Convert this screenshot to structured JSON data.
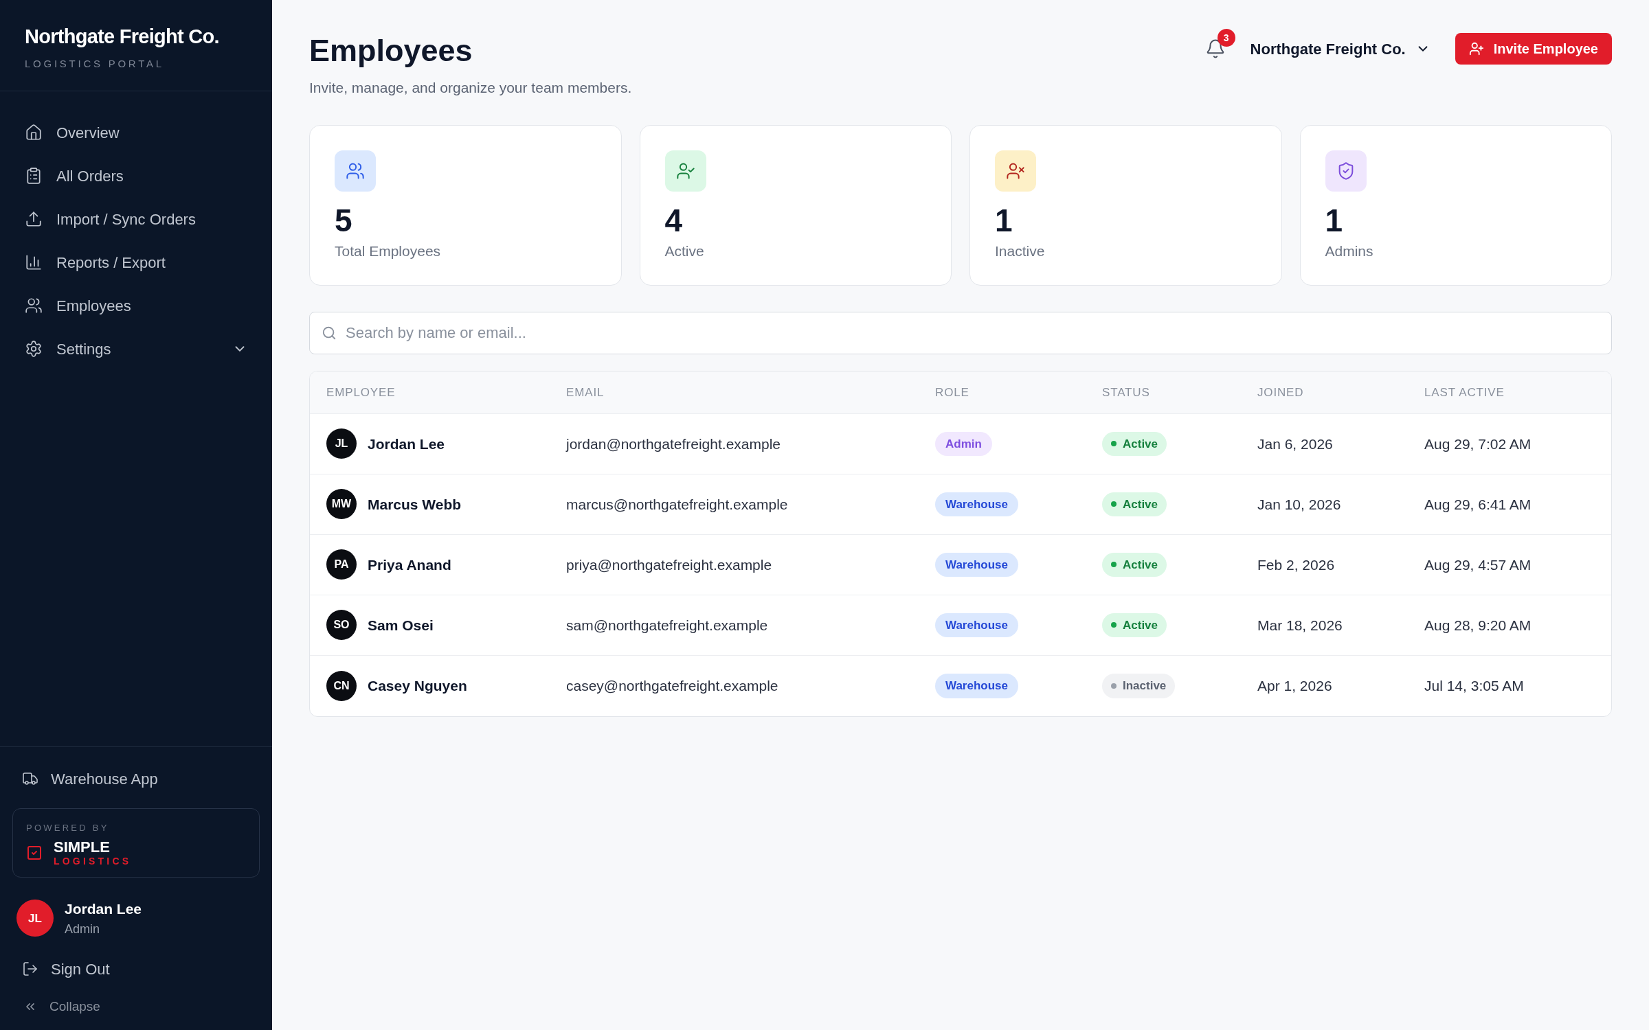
{
  "sidebar": {
    "brand": {
      "name": "Northgate Freight Co.",
      "tagline": "LOGISTICS PORTAL"
    },
    "nav": [
      {
        "label": "Overview",
        "kind": "home",
        "selected": false
      },
      {
        "label": "All Orders",
        "kind": "orders",
        "selected": false
      },
      {
        "label": "Import / Sync Orders",
        "kind": "upload",
        "selected": false
      },
      {
        "label": "Reports / Export",
        "kind": "chart",
        "selected": false
      },
      {
        "label": "Employees",
        "kind": "users",
        "selected": false
      },
      {
        "label": "Settings",
        "kind": "settings",
        "selected": false,
        "expanded": false
      }
    ],
    "warehouse_link": "Warehouse App",
    "powered_by": {
      "caption": "POWERED BY",
      "name": "SIMPLE",
      "subname": "LOGISTICS"
    },
    "user": {
      "initials": "JL",
      "name": "Jordan Lee",
      "role": "Admin"
    },
    "sign_out": "Sign Out",
    "collapse": "Collapse"
  },
  "header": {
    "notifications": "3",
    "company": "Northgate Freight Co.",
    "invite_button": "Invite Employee"
  },
  "page": {
    "title": "Employees",
    "subtitle": "Invite, manage, and organize your team members."
  },
  "stats": [
    {
      "kind": "total",
      "value": "5",
      "label": "Total Employees"
    },
    {
      "kind": "active",
      "value": "4",
      "label": "Active"
    },
    {
      "kind": "inactive",
      "value": "1",
      "label": "Inactive"
    },
    {
      "kind": "admins",
      "value": "1",
      "label": "Admins"
    }
  ],
  "search": {
    "placeholder": "Search by name or email..."
  },
  "table": {
    "columns": [
      "EMPLOYEE",
      "EMAIL",
      "ROLE",
      "STATUS",
      "JOINED",
      "LAST ACTIVE"
    ],
    "rows": [
      {
        "initials": "JL",
        "name": "Jordan Lee",
        "email": "jordan@northgatefreight.example",
        "role": {
          "kind": "admin",
          "label": "Admin"
        },
        "status": {
          "kind": "active",
          "label": "Active"
        },
        "joined": "Jan 6, 2026",
        "last_active": "Aug 29, 7:02 AM"
      },
      {
        "initials": "MW",
        "name": "Marcus Webb",
        "email": "marcus@northgatefreight.example",
        "role": {
          "kind": "warehouse",
          "label": "Warehouse"
        },
        "status": {
          "kind": "active",
          "label": "Active"
        },
        "joined": "Jan 10, 2026",
        "last_active": "Aug 29, 6:41 AM"
      },
      {
        "initials": "PA",
        "name": "Priya Anand",
        "email": "priya@northgatefreight.example",
        "role": {
          "kind": "warehouse",
          "label": "Warehouse"
        },
        "status": {
          "kind": "active",
          "label": "Active"
        },
        "joined": "Feb 2, 2026",
        "last_active": "Aug 29, 4:57 AM"
      },
      {
        "initials": "SO",
        "name": "Sam Osei",
        "email": "sam@northgatefreight.example",
        "role": {
          "kind": "warehouse",
          "label": "Warehouse"
        },
        "status": {
          "kind": "active",
          "label": "Active"
        },
        "joined": "Mar 18, 2026",
        "last_active": "Aug 28, 9:20 AM"
      },
      {
        "initials": "CN",
        "name": "Casey Nguyen",
        "email": "casey@northgatefreight.example",
        "role": {
          "kind": "warehouse",
          "label": "Warehouse"
        },
        "status": {
          "kind": "inactive",
          "label": "Inactive"
        },
        "joined": "Apr 1, 2026",
        "last_active": "Jul 14, 3:05 AM"
      }
    ]
  }
}
